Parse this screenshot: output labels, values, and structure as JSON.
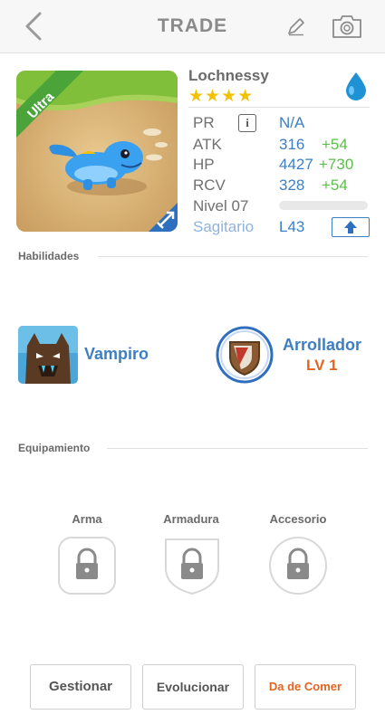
{
  "header": {
    "title": "TRADE",
    "back_icon": "chevron-left-icon",
    "edit_icon": "pencil-icon",
    "camera_icon": "camera-icon"
  },
  "monster": {
    "name": "Lochnessy",
    "stars": "★★★★",
    "rank_ribbon": "Ultra",
    "element_icon": "water-drop-icon",
    "class_icon": "bow-arrow-icon",
    "stats": {
      "pr_label": "PR",
      "pr_value": "N/A",
      "atk_label": "ATK",
      "atk_value": "316",
      "atk_bonus": "+54",
      "hp_label": "HP",
      "hp_value": "4427",
      "hp_bonus": "+730",
      "rcv_label": "RCV",
      "rcv_value": "328",
      "rcv_bonus": "+54",
      "level_label": "Nivel 07",
      "sign_label": "Sagitario",
      "sign_level": "L43"
    }
  },
  "skills": {
    "section_label": "Habilidades",
    "skill1": {
      "name": "Vampiro"
    },
    "skill2": {
      "name": "Arrollador",
      "level": "LV 1"
    }
  },
  "equipment": {
    "section_label": "Equipamiento",
    "slots": [
      {
        "label": "Arma"
      },
      {
        "label": "Armadura"
      },
      {
        "label": "Accesorio"
      }
    ]
  },
  "actions": {
    "manage": "Gestionar",
    "evolve": "Evolucionar",
    "feed": "Da de Comer"
  },
  "colors": {
    "accent_blue": "#3d7fc3",
    "bonus_green": "#5cbf4a",
    "feed_orange": "#e4641e",
    "star_gold": "#f2c200",
    "ribbon_green": "#4aa43a"
  }
}
